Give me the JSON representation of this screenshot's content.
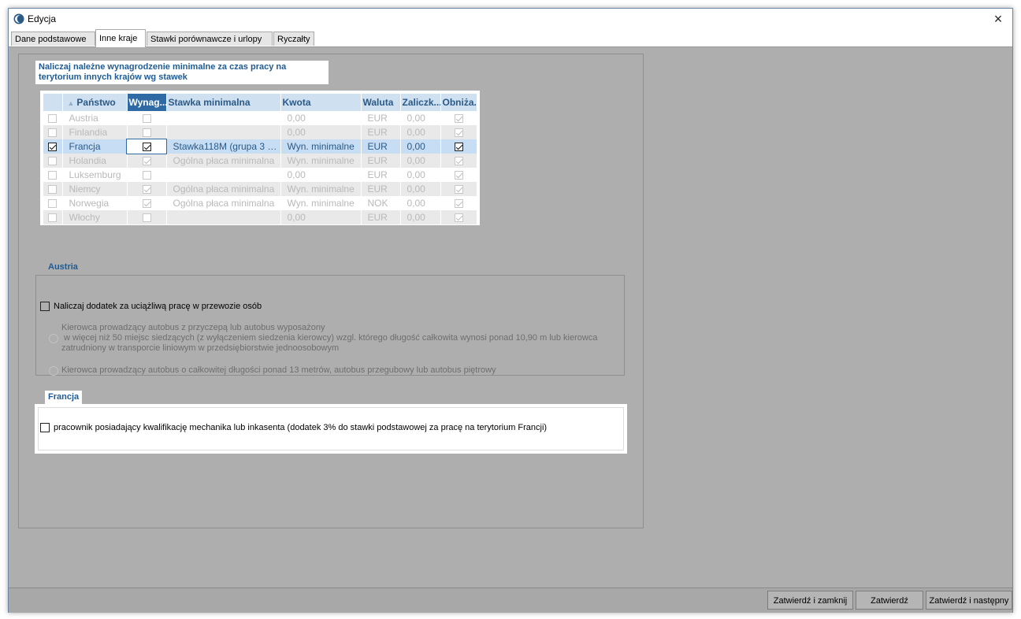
{
  "window": {
    "title": "Edycja",
    "close_icon": "×"
  },
  "tabs": [
    {
      "label": "Dane podstawowe"
    },
    {
      "label": "Inne kraje"
    },
    {
      "label": "Stawki porównawcze i urlopy"
    },
    {
      "label": "Ryczałty"
    }
  ],
  "main": {
    "heading": "Naliczaj należne wynagrodzenie minimalne za czas pracy na terytorium innych krajów wg stawek",
    "table": {
      "columns": [
        "Państwo",
        "Wynag...",
        "Stawka minimalna",
        "Kwota",
        "Waluta",
        "Zaliczk...",
        "Obniża..."
      ],
      "rows": [
        {
          "selected": false,
          "country": "Austria",
          "wynag": false,
          "stawka": "",
          "kwota": "0,00",
          "waluta": "EUR",
          "zal": "0,00",
          "obniz": true
        },
        {
          "selected": false,
          "country": "Finlandia",
          "wynag": false,
          "stawka": "",
          "kwota": "0,00",
          "waluta": "EUR",
          "zal": "0,00",
          "obniz": true
        },
        {
          "selected": true,
          "country": "Francja",
          "wynag": true,
          "stawka": "Stawka118M (grupa 3 b...",
          "kwota": "Wyn. minimalne",
          "waluta": "EUR",
          "zal": "0,00",
          "obniz": true
        },
        {
          "selected": false,
          "country": "Holandia",
          "wynag": true,
          "stawka": "Ogólna płaca minimalna",
          "kwota": "Wyn. minimalne",
          "waluta": "EUR",
          "zal": "0,00",
          "obniz": true
        },
        {
          "selected": false,
          "country": "Luksemburg",
          "wynag": false,
          "stawka": "",
          "kwota": "0,00",
          "waluta": "EUR",
          "zal": "0,00",
          "obniz": true
        },
        {
          "selected": false,
          "country": "Niemcy",
          "wynag": true,
          "stawka": "Ogólna płaca minimalna",
          "kwota": "Wyn. minimalne",
          "waluta": "EUR",
          "zal": "0,00",
          "obniz": true
        },
        {
          "selected": false,
          "country": "Norwegia",
          "wynag": true,
          "stawka": "Ogólna płaca minimalna",
          "kwota": "Wyn. minimalne",
          "waluta": "NOK",
          "zal": "0,00",
          "obniz": true
        },
        {
          "selected": false,
          "country": "Włochy",
          "wynag": false,
          "stawka": "",
          "kwota": "0,00",
          "waluta": "EUR",
          "zal": "0,00",
          "obniz": true
        }
      ]
    }
  },
  "austria": {
    "label": "Austria",
    "checkbox_label": "Naliczaj dodatek za uciążliwą pracę w przewozie osób",
    "radio1_lines": [
      "Kierowca prowadzący autobus z przyczepą lub autobus wyposażony",
      " w więcej niż 50 miejsc siedzących (z wyłączeniem siedzenia kierowcy) wzgl. którego długość całkowita wynosi ponad 10,90 m lub kierowca",
      "zatrudniony w transporcie liniowym w przedsiębiorstwie jednoosobowym"
    ],
    "radio2_label": "Kierowca prowadzący autobus o całkowitej długości ponad 13 metrów, autobus przegubowy lub autobus piętrowy"
  },
  "francja": {
    "label": "Francja",
    "checkbox_label": "pracownik posiadający kwalifikację mechanika lub inkasenta (dodatek 3% do stawki podstawowej za pracę na terytorium Francji)"
  },
  "buttons": {
    "confirm_close": "Zatwierdź i zamknij",
    "confirm": "Zatwierdź",
    "confirm_next": "Zatwierdź i następny"
  },
  "colors": {
    "accent": "#1e5b94",
    "header_bg": "#cfe0f0",
    "selected_header": "#2f6aa5",
    "dialog_bg": "#aeaeae"
  }
}
